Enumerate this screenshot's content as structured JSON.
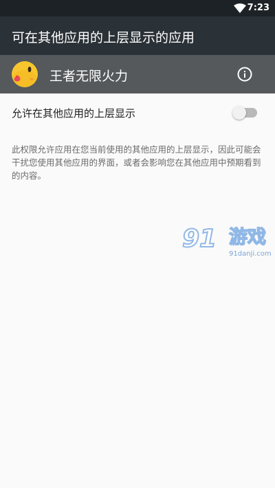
{
  "status_bar": {
    "time": "7:23",
    "wifi_icon": "wifi-icon"
  },
  "app_bar": {
    "title": "可在其他应用的上层显示的应用"
  },
  "app_header": {
    "app_name": "王者无限火力",
    "avatar_icon": "emoji-face-icon",
    "info_icon": "info-icon"
  },
  "permission": {
    "label": "允许在其他应用的上层显示",
    "enabled": false,
    "description": "此权限允许应用在您当前使用的其他应用的上层显示，因此可能会干扰您使用其他应用的界面，或者会影响您在其他应用中预期看到的内容。"
  },
  "watermark": {
    "number": "91",
    "name": "游戏",
    "url": "91danji.com"
  },
  "colors": {
    "status_bar": "#1d2226",
    "app_bar": "#2b3237",
    "app_header": "#55595c",
    "background": "#fafafa",
    "switch_track_off": "#b9b9b9",
    "switch_thumb_off": "#f1f1f1"
  }
}
